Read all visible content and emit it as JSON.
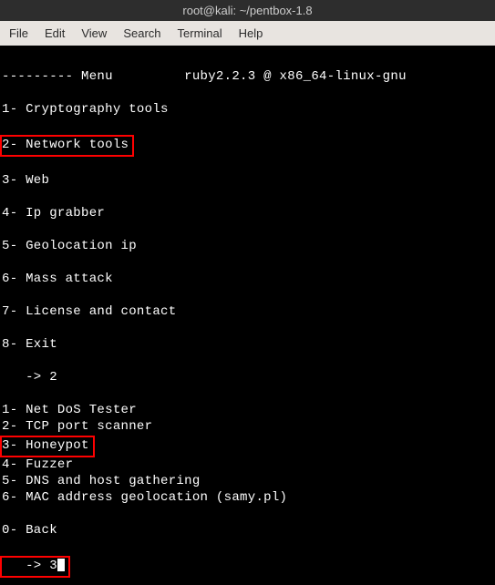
{
  "window": {
    "title": "root@kali: ~/pentbox-1.8"
  },
  "menubar": {
    "file": "File",
    "edit": "Edit",
    "view": "View",
    "search": "Search",
    "terminal": "Terminal",
    "help": "Help"
  },
  "terminal": {
    "header": "--------- Menu         ruby2.2.3 @ x86_64-linux-gnu",
    "main_menu": {
      "item1": "1- Cryptography tools",
      "item2": "2- Network tools",
      "item3": "3- Web",
      "item4": "4- Ip grabber",
      "item5": "5- Geolocation ip",
      "item6": "6- Mass attack",
      "item7": "7- License and contact",
      "item8": "8- Exit"
    },
    "prompt1": "   -> 2",
    "sub_menu": {
      "item1": "1- Net DoS Tester",
      "item2": "2- TCP port scanner",
      "item3": "3- Honeypot",
      "item4": "4- Fuzzer",
      "item5": "5- DNS and host gathering",
      "item6": "6- MAC address geolocation (samy.pl)",
      "item0": "0- Back"
    },
    "prompt2_pre": "   -> 3"
  }
}
